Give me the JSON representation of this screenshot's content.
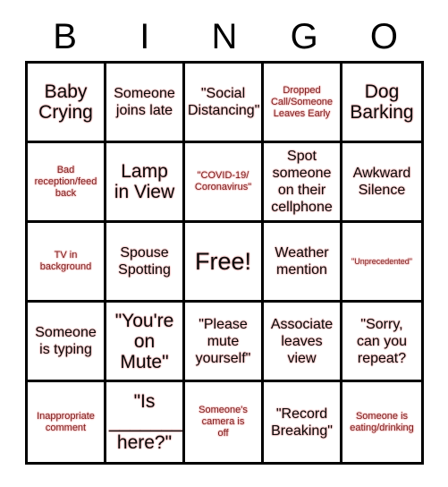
{
  "card": {
    "header_letters": [
      "B",
      "I",
      "N",
      "G",
      "O"
    ],
    "rows": 5,
    "columns": 5,
    "colors": {
      "background": "#ffffff",
      "border": "#000000",
      "header_text": "#000000",
      "large_text": "#0a0a0a",
      "small_text": "#7b1d1d",
      "text_halo": "#f7c9c9"
    },
    "cells": [
      [
        {
          "text": "Baby\nCrying",
          "size": "big"
        },
        {
          "text": "Someone\njoins late",
          "size": "med"
        },
        {
          "text": "\"Social\nDistancing\"",
          "size": "med"
        },
        {
          "text": "Dropped\nCall/Someone\nLeaves Early",
          "size": "small"
        },
        {
          "text": "Dog\nBarking",
          "size": "big"
        }
      ],
      [
        {
          "text": "Bad\nreception/feed\nback",
          "size": "small"
        },
        {
          "text": "Lamp\nin View",
          "size": "big"
        },
        {
          "text": "\"COVID-19/\nCoronavirus\"",
          "size": "small"
        },
        {
          "text": "Spot\nsomeone\non their\ncellphone",
          "size": "med"
        },
        {
          "text": "Awkward\nSilence",
          "size": "med"
        }
      ],
      [
        {
          "text": "TV in\nbackground",
          "size": "small"
        },
        {
          "text": "Spouse\nSpotting",
          "size": "med"
        },
        {
          "text": "Free!",
          "size": "free"
        },
        {
          "text": "Weather\nmention",
          "size": "med"
        },
        {
          "text": "\"Unprecedented\"",
          "size": "xsmall"
        }
      ],
      [
        {
          "text": "Someone\nis typing",
          "size": "med"
        },
        {
          "text": "\"You're\non\nMute\"",
          "size": "big"
        },
        {
          "text": "\"Please\nmute\nyourself\"",
          "size": "med"
        },
        {
          "text": "Associate\nleaves\nview",
          "size": "med"
        },
        {
          "text": "\"Sorry,\ncan you\nrepeat?",
          "size": "med"
        }
      ],
      [
        {
          "text": "Inappropriate\ncomment",
          "size": "small"
        },
        {
          "text": "\"Is\n_______\nhere?\"",
          "size": "big"
        },
        {
          "text": "Someone's\ncamera is\noff",
          "size": "small"
        },
        {
          "text": "\"Record\nBreaking\"",
          "size": "med"
        },
        {
          "text": "Someone is\neating/drinking",
          "size": "small"
        }
      ]
    ]
  }
}
